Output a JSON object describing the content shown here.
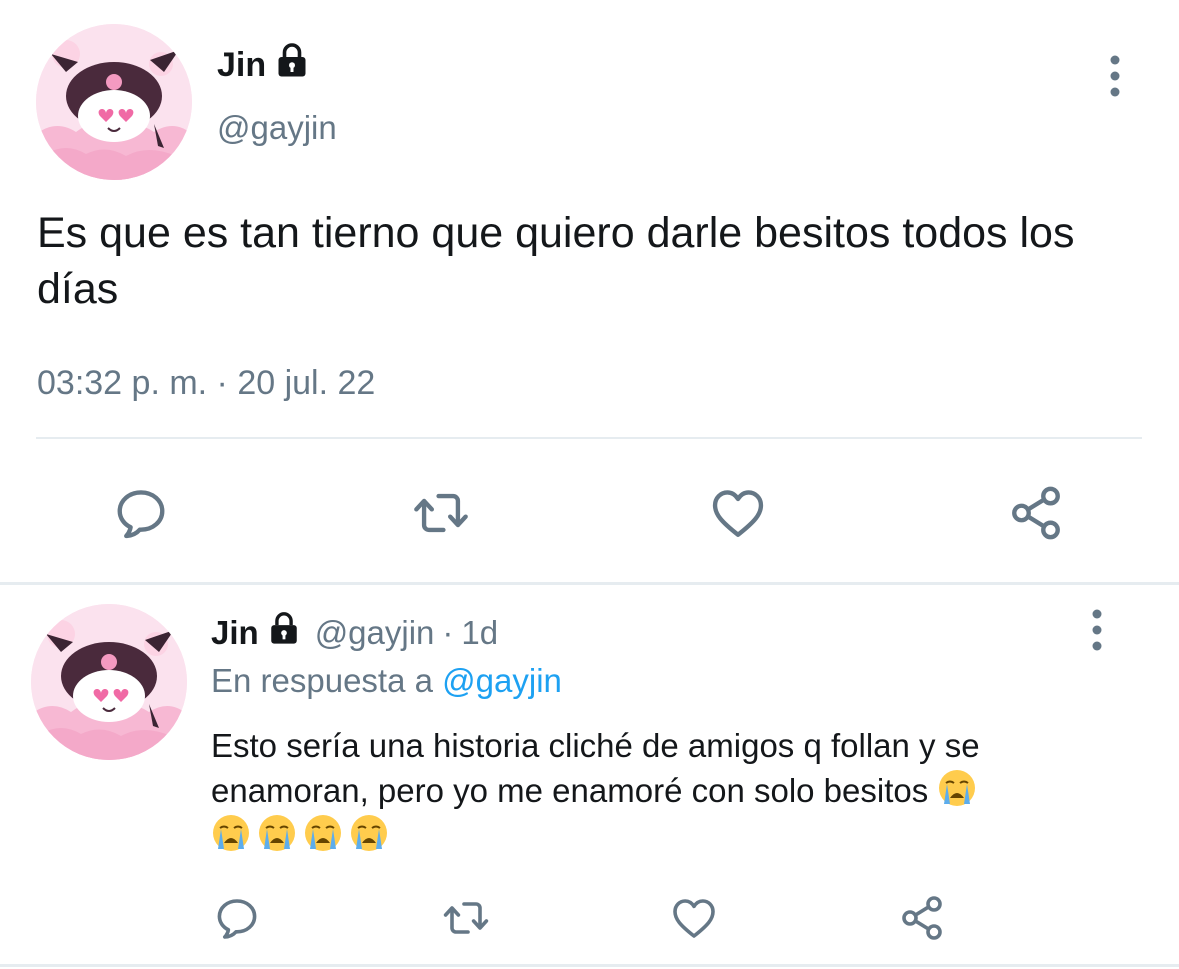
{
  "main_tweet": {
    "display_name": "Jin",
    "handle": "@gayjin",
    "text": "Es que es tan tierno que quiero darle besitos todos los días",
    "timestamp": "03:32 p. m. · 20 jul. 22",
    "protected_icon": "lock-icon",
    "actions": [
      "reply-icon",
      "retweet-icon",
      "like-icon",
      "share-icon"
    ]
  },
  "reply_tweet": {
    "display_name": "Jin",
    "handle": "@gayjin",
    "separator": "·",
    "age": "1d",
    "reply_prefix": "En respuesta a ",
    "reply_to_handle": "@gayjin",
    "text": "Esto sería una historia cliché de amigos q follan y se enamoran, pero yo me enamoré con solo besitos",
    "emoji": "loudly-crying-face",
    "emoji_count": 5,
    "protected_icon": "lock-icon",
    "actions": [
      "reply-icon",
      "retweet-icon",
      "like-icon",
      "share-icon"
    ]
  },
  "colors": {
    "text_primary": "#14171a",
    "text_secondary": "#657786",
    "link": "#1da1f2",
    "divider": "#e6ecf0",
    "icon": "#657786"
  }
}
